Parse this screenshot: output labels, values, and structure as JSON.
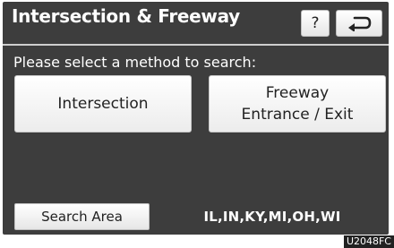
{
  "header": {
    "title": "Intersection & Freeway",
    "help_label": "?",
    "help_icon": "question-icon",
    "back_icon": "return-arrow-icon"
  },
  "main": {
    "prompt": "Please select a method to search:",
    "options": {
      "intersection": "Intersection",
      "freeway_line1": "Freeway",
      "freeway_line2": "Entrance / Exit"
    }
  },
  "footer": {
    "search_area_label": "Search Area",
    "search_area_value": "IL,IN,KY,MI,OH,WI"
  },
  "figure_code": "U2048FC",
  "colors": {
    "screen_background": "#3d3d3d",
    "button_face": "#ffffff",
    "text_light": "#ffffff",
    "text_dark": "#222222"
  }
}
